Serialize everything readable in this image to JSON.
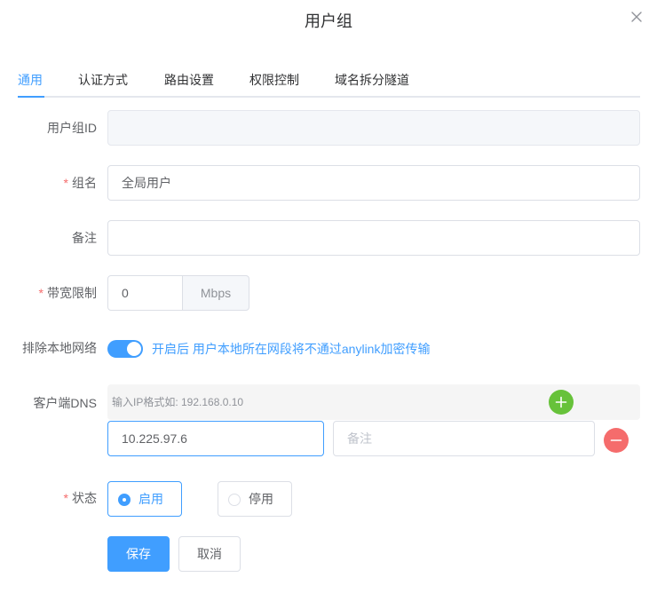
{
  "dialog": {
    "title": "用户组"
  },
  "tabs": [
    {
      "label": "通用",
      "active": true
    },
    {
      "label": "认证方式"
    },
    {
      "label": "路由设置"
    },
    {
      "label": "权限控制"
    },
    {
      "label": "域名拆分隧道"
    }
  ],
  "form": {
    "group_id": {
      "label": "用户组ID",
      "value": ""
    },
    "group_name": {
      "label": "组名",
      "required_mark": "*",
      "value": "全局用户"
    },
    "remark": {
      "label": "备注",
      "value": ""
    },
    "bandwidth": {
      "label": "带宽限制",
      "required_mark": "*",
      "value": "0",
      "unit": "Mbps"
    },
    "exclude_local": {
      "label": "排除本地网络",
      "on": true,
      "text": "开启后 用户本地所在网段将不通过anylink加密传输"
    },
    "client_dns": {
      "label": "客户端DNS",
      "hint": "输入IP格式如: 192.168.0.10",
      "entries": [
        {
          "ip": "10.225.97.6",
          "remark_placeholder": "备注"
        }
      ]
    },
    "status": {
      "label": "状态",
      "required_mark": "*",
      "options": [
        {
          "label": "启用",
          "checked": true
        },
        {
          "label": "停用",
          "checked": false
        }
      ]
    }
  },
  "actions": {
    "save_label": "保存",
    "cancel_label": "取消"
  },
  "icons": {
    "close": "close-icon",
    "add": "plus-icon",
    "remove": "minus-icon"
  },
  "colors": {
    "primary": "#409eff",
    "success": "#67c23a",
    "danger": "#f56c6c"
  }
}
